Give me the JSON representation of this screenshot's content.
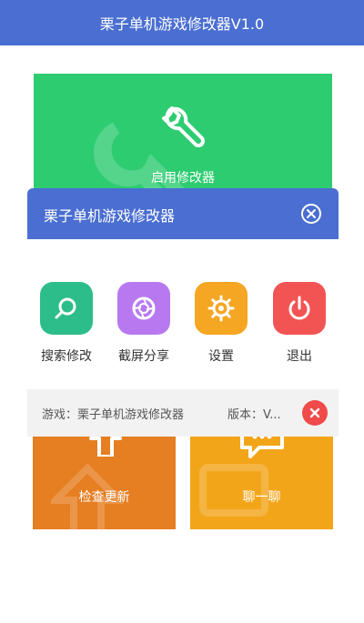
{
  "app": {
    "title": "栗子单机游戏修改器V1.0"
  },
  "tiles": {
    "enable": {
      "label": "启用修改器",
      "color": "#2ecc71"
    },
    "update": {
      "label": "检查更新",
      "color": "#e67e22"
    },
    "chat": {
      "label": "聊一聊",
      "color": "#f3a51a"
    }
  },
  "dialog": {
    "title": "栗子单机游戏修改器",
    "close_icon": "close-circle-icon",
    "menu": [
      {
        "label": "搜索修改",
        "icon": "search-icon",
        "color": "#2dbd8a"
      },
      {
        "label": "截屏分享",
        "icon": "camera-aperture-icon",
        "color": "#b879f0"
      },
      {
        "label": "设置",
        "icon": "gear-icon",
        "color": "#f5a623"
      },
      {
        "label": "退出",
        "icon": "power-icon",
        "color": "#f25454"
      }
    ]
  },
  "info": {
    "game": "游戏：栗子单机游戏修改器",
    "version": "版本：V..."
  },
  "colors": {
    "accent": "#4a6ed1"
  }
}
